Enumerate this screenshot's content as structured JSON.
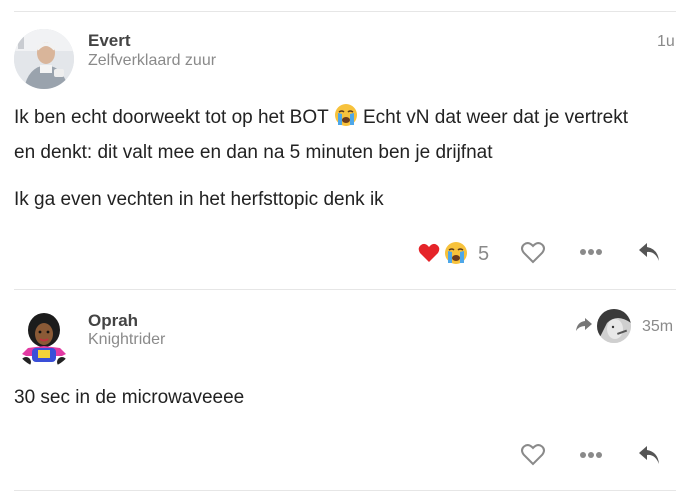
{
  "top_divider": true,
  "posts": [
    {
      "author": "Evert",
      "user_title": "Zelfverklaard zuur",
      "time": "1u",
      "paragraphs": [
        {
          "before": "Ik ben echt doorweekt tot op het BOT ",
          "emoji": "crying-face",
          "after": " Echt vN dat weer dat je vertrekt"
        },
        {
          "text": "en denkt: dit valt mee en dan na 5 minuten ben je drijfnat"
        },
        {
          "text": "Ik ga even vechten in het herfsttopic denk ik"
        }
      ],
      "reactions": {
        "emojis": [
          "heart",
          "crying-face"
        ],
        "count": "5"
      },
      "actions": [
        "like-icon",
        "more-icon",
        "reply-icon"
      ]
    },
    {
      "author": "Oprah",
      "user_title": "Knightrider",
      "time": "35m",
      "reply_to_avatar": "reply-avatar",
      "paragraphs": [
        {
          "text": "30 sec in de microwaveeee"
        }
      ],
      "actions": [
        "like-icon",
        "more-icon",
        "reply-icon"
      ]
    }
  ]
}
